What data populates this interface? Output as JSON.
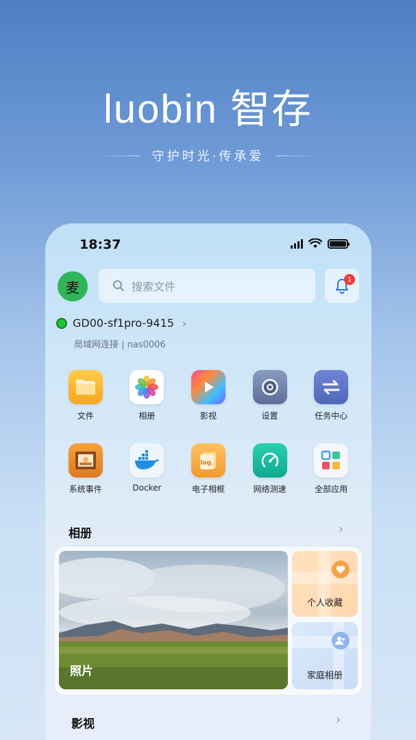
{
  "hero": {
    "title": "luobin 智存",
    "subtitle": "守护时光·传承爱"
  },
  "status_bar": {
    "time": "18:37"
  },
  "header": {
    "avatar_text": "麦",
    "search_placeholder": "搜索文件",
    "notification_count": "1"
  },
  "device": {
    "name": "GD00-sf1pro-9415",
    "status_text": "局域网连接 | nas0006",
    "online_color": "#22c431"
  },
  "apps": [
    {
      "label": "文件",
      "icon": "folder-icon"
    },
    {
      "label": "相册",
      "icon": "photos-icon"
    },
    {
      "label": "影视",
      "icon": "video-play-icon"
    },
    {
      "label": "设置",
      "icon": "settings-gear-icon"
    },
    {
      "label": "任务中心",
      "icon": "transfer-arrows-icon"
    },
    {
      "label": "系统事件",
      "icon": "picture-frame-icon"
    },
    {
      "label": "Docker",
      "icon": "docker-whale-icon"
    },
    {
      "label": "电子相框",
      "icon": "log-file-icon"
    },
    {
      "label": "网络测速",
      "icon": "speedometer-icon"
    },
    {
      "label": "全部应用",
      "icon": "app-grid-icon"
    }
  ],
  "album_section": {
    "title": "相册",
    "photos_label": "照片",
    "favorites_label": "个人收藏",
    "family_label": "家庭相册"
  },
  "video_section": {
    "title": "影视"
  }
}
